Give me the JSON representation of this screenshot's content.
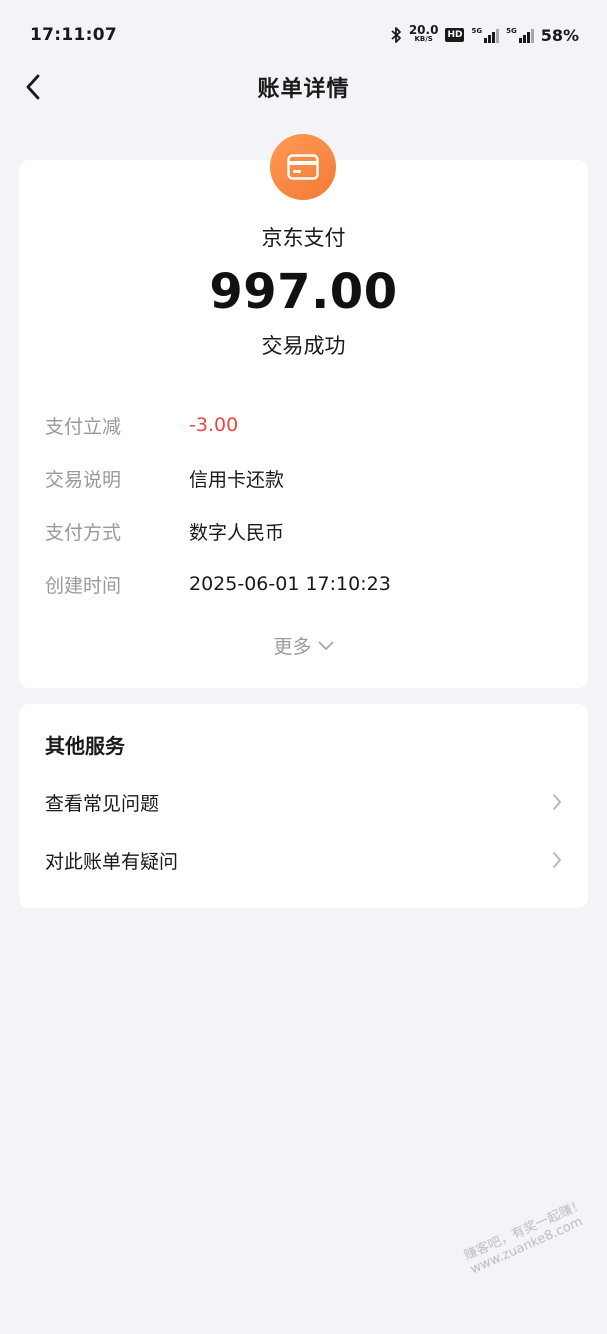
{
  "status_bar": {
    "time": "17:11:07",
    "net_speed_value": "20.0",
    "net_speed_unit": "KB/S",
    "hd_label": "HD",
    "signal_tag": "5G",
    "battery": "58%"
  },
  "nav": {
    "title": "账单详情",
    "back_icon": "chevron-left-icon"
  },
  "bill": {
    "merchant_icon": "card-icon",
    "accent_color": "#f47a35",
    "merchant": "京东支付",
    "amount": "997.00",
    "status": "交易成功",
    "details": [
      {
        "label": "支付立减",
        "value": "-3.00"
      },
      {
        "label": "交易说明",
        "value": "信用卡还款"
      },
      {
        "label": "支付方式",
        "value": "数字人民币"
      },
      {
        "label": "创建时间",
        "value": "2025-06-01 17:10:23"
      }
    ],
    "discount_color": "#e8473f",
    "more_label": "更多"
  },
  "services": {
    "title": "其他服务",
    "items": [
      {
        "label": "查看常见问题"
      },
      {
        "label": "对此账单有疑问"
      }
    ]
  },
  "watermark": {
    "line1": "赚客吧，有奖一起赚！",
    "line2": "www.zuanke8.com"
  }
}
